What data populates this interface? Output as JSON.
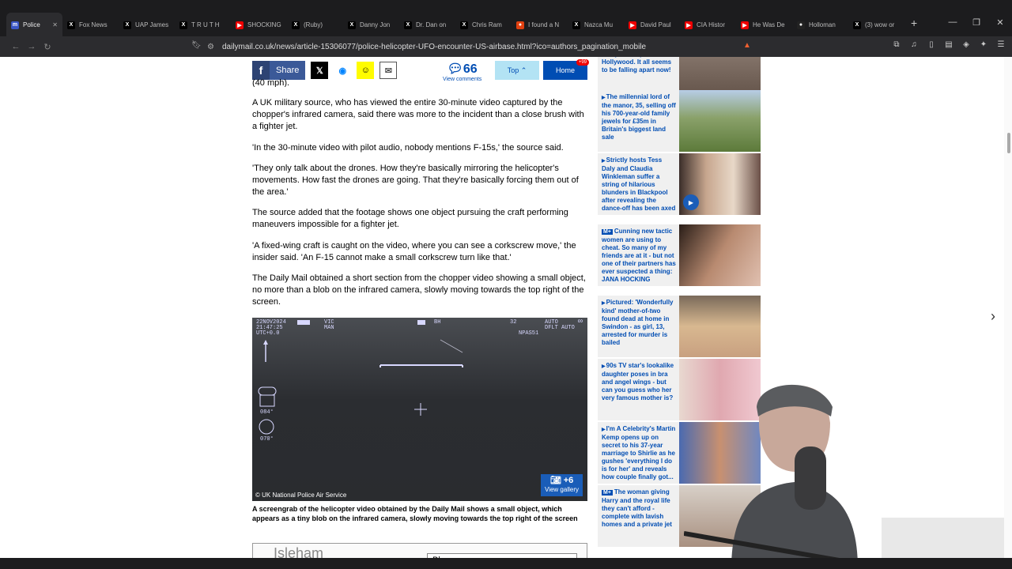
{
  "tabs": [
    {
      "title": "Police",
      "fav": "m",
      "color": "#3b57c7",
      "active": true
    },
    {
      "title": "Fox News",
      "fav": "X",
      "color": "#000"
    },
    {
      "title": "UAP James",
      "fav": "X",
      "color": "#000"
    },
    {
      "title": "T R U T H",
      "fav": "X",
      "color": "#000"
    },
    {
      "title": "SHOCKING",
      "fav": "▶",
      "color": "#e00"
    },
    {
      "title": "(Ruby)",
      "fav": "X",
      "color": "#000"
    },
    {
      "title": "Danny Jon",
      "fav": "X",
      "color": "#000"
    },
    {
      "title": "Dr. Dan on",
      "fav": "X",
      "color": "#000"
    },
    {
      "title": "Chris Ram",
      "fav": "X",
      "color": "#000"
    },
    {
      "title": "I found a N",
      "fav": "●",
      "color": "#e04010"
    },
    {
      "title": "Nazca Mu",
      "fav": "X",
      "color": "#000"
    },
    {
      "title": "David Paul",
      "fav": "▶",
      "color": "#e00"
    },
    {
      "title": "CIA Histor",
      "fav": "▶",
      "color": "#e00"
    },
    {
      "title": "He Was De",
      "fav": "▶",
      "color": "#e00"
    },
    {
      "title": "Holloman",
      "fav": "●",
      "color": "#222"
    },
    {
      "title": "(3) wow or",
      "fav": "X",
      "color": "#000"
    }
  ],
  "address": "dailymail.co.uk/news/article-15306077/police-helicopter-UFO-encounter-US-airbase.html?ico=authors_pagination_mobile",
  "share": {
    "share_label": "Share",
    "comment_count": "66",
    "comment_label": "View comments",
    "top_label": "Top",
    "home_label": "Home",
    "home_badge": "+99"
  },
  "article": {
    "partial_top": "(40 mph).",
    "p1": "A UK military source, who has viewed the entire 30-minute video captured by the chopper's infrared camera, said there was more to the incident than a close brush with a fighter jet.",
    "p2": "'In the 30-minute video with pilot audio, nobody mentions F-15s,' the source said.",
    "p3": "'They only talk about the drones. How they're basically mirroring the helicopter's movements. How fast the drones are going. That they're basically forcing them out of the area.'",
    "p4": "The source added that the footage shows one object pursuing the craft performing maneuvers impossible for a fighter jet.",
    "p5": "'A fixed-wing craft is caught on the video, where you can see a corkscrew move,' the insider said. 'An F-15 cannot make a small corkscrew turn like that.'",
    "p6": "The Daily Mail obtained a short section from the chopper video showing a small object, no more than a blob on the infrared camera, slowly moving towards the top right of the screen.",
    "video_credit": "© UK National Police Air Service",
    "gallery_count": "+6",
    "gallery_label": "View gallery",
    "caption": "A screengrab of the helicopter video obtained by the Daily Mail shows a small object, which appears as a tiny blob on the infrared camera, slowly moving towards the top right of the screen",
    "next_image_text": "Isleham",
    "next_image_box": "Bla"
  },
  "hud": {
    "date": "22NOV2024",
    "time": "21:47:25",
    "utc": "UTC+0.0",
    "vic": "VIC",
    "man": "MAN",
    "bh": "BH",
    "num": "32",
    "auto": "AUTO",
    "dflt": "DFLT",
    "auto2": "AUTO",
    "npas": "NPAS51",
    "inf": "∞",
    "a1": "084°",
    "a2": "070°"
  },
  "sidebar": [
    {
      "text": "everyone's lips in Hollywood. It all seems to be falling apart now!",
      "plus": false
    },
    {
      "text": "The millennial lord of the manor, 35, selling off his 700-year-old family jewels for £35m in Britain's biggest land sale",
      "plus": false
    },
    {
      "text": "Strictly hosts Tess Daly and Claudia Winkleman suffer a string of hilarious blunders in Blackpool after revealing the dance-off has been axed",
      "plus": false,
      "play": true
    },
    {
      "text": "Cunning new tactic women are using to cheat. So many of my friends are at it - but not one of their partners has ever suspected a thing: JANA HOCKING",
      "plus": true
    },
    {
      "text": "Pictured: 'Wonderfully kind' mother-of-two found dead at home in Swindon - as girl, 13, arrested for murder is bailed",
      "plus": false
    },
    {
      "text": "90s TV star's lookalike daughter poses in bra and angel wings - but can you guess who her very famous mother is?",
      "plus": false
    },
    {
      "text": "I'm A Celebrity's Martin Kemp opens up on secret to his 37-year marriage to Shirlie as he gushes 'everything I do is for her' and reveals how couple finally got...",
      "plus": false
    },
    {
      "text": "The woman giving Harry and the royal life they can't afford - complete with lavish homes and a private jet",
      "plus": true
    }
  ]
}
